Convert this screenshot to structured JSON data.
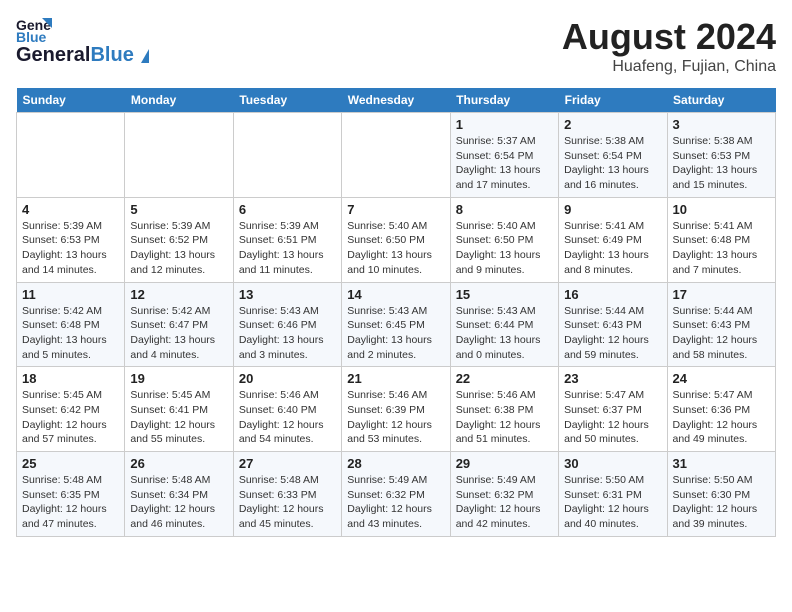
{
  "header": {
    "logo_general": "General",
    "logo_blue": "Blue",
    "title": "August 2024",
    "subtitle": "Huafeng, Fujian, China"
  },
  "days_of_week": [
    "Sunday",
    "Monday",
    "Tuesday",
    "Wednesday",
    "Thursday",
    "Friday",
    "Saturday"
  ],
  "weeks": [
    [
      {
        "day": "",
        "info": ""
      },
      {
        "day": "",
        "info": ""
      },
      {
        "day": "",
        "info": ""
      },
      {
        "day": "",
        "info": ""
      },
      {
        "day": "1",
        "info": "Sunrise: 5:37 AM\nSunset: 6:54 PM\nDaylight: 13 hours\nand 17 minutes."
      },
      {
        "day": "2",
        "info": "Sunrise: 5:38 AM\nSunset: 6:54 PM\nDaylight: 13 hours\nand 16 minutes."
      },
      {
        "day": "3",
        "info": "Sunrise: 5:38 AM\nSunset: 6:53 PM\nDaylight: 13 hours\nand 15 minutes."
      }
    ],
    [
      {
        "day": "4",
        "info": "Sunrise: 5:39 AM\nSunset: 6:53 PM\nDaylight: 13 hours\nand 14 minutes."
      },
      {
        "day": "5",
        "info": "Sunrise: 5:39 AM\nSunset: 6:52 PM\nDaylight: 13 hours\nand 12 minutes."
      },
      {
        "day": "6",
        "info": "Sunrise: 5:39 AM\nSunset: 6:51 PM\nDaylight: 13 hours\nand 11 minutes."
      },
      {
        "day": "7",
        "info": "Sunrise: 5:40 AM\nSunset: 6:50 PM\nDaylight: 13 hours\nand 10 minutes."
      },
      {
        "day": "8",
        "info": "Sunrise: 5:40 AM\nSunset: 6:50 PM\nDaylight: 13 hours\nand 9 minutes."
      },
      {
        "day": "9",
        "info": "Sunrise: 5:41 AM\nSunset: 6:49 PM\nDaylight: 13 hours\nand 8 minutes."
      },
      {
        "day": "10",
        "info": "Sunrise: 5:41 AM\nSunset: 6:48 PM\nDaylight: 13 hours\nand 7 minutes."
      }
    ],
    [
      {
        "day": "11",
        "info": "Sunrise: 5:42 AM\nSunset: 6:48 PM\nDaylight: 13 hours\nand 5 minutes."
      },
      {
        "day": "12",
        "info": "Sunrise: 5:42 AM\nSunset: 6:47 PM\nDaylight: 13 hours\nand 4 minutes."
      },
      {
        "day": "13",
        "info": "Sunrise: 5:43 AM\nSunset: 6:46 PM\nDaylight: 13 hours\nand 3 minutes."
      },
      {
        "day": "14",
        "info": "Sunrise: 5:43 AM\nSunset: 6:45 PM\nDaylight: 13 hours\nand 2 minutes."
      },
      {
        "day": "15",
        "info": "Sunrise: 5:43 AM\nSunset: 6:44 PM\nDaylight: 13 hours\nand 0 minutes."
      },
      {
        "day": "16",
        "info": "Sunrise: 5:44 AM\nSunset: 6:43 PM\nDaylight: 12 hours\nand 59 minutes."
      },
      {
        "day": "17",
        "info": "Sunrise: 5:44 AM\nSunset: 6:43 PM\nDaylight: 12 hours\nand 58 minutes."
      }
    ],
    [
      {
        "day": "18",
        "info": "Sunrise: 5:45 AM\nSunset: 6:42 PM\nDaylight: 12 hours\nand 57 minutes."
      },
      {
        "day": "19",
        "info": "Sunrise: 5:45 AM\nSunset: 6:41 PM\nDaylight: 12 hours\nand 55 minutes."
      },
      {
        "day": "20",
        "info": "Sunrise: 5:46 AM\nSunset: 6:40 PM\nDaylight: 12 hours\nand 54 minutes."
      },
      {
        "day": "21",
        "info": "Sunrise: 5:46 AM\nSunset: 6:39 PM\nDaylight: 12 hours\nand 53 minutes."
      },
      {
        "day": "22",
        "info": "Sunrise: 5:46 AM\nSunset: 6:38 PM\nDaylight: 12 hours\nand 51 minutes."
      },
      {
        "day": "23",
        "info": "Sunrise: 5:47 AM\nSunset: 6:37 PM\nDaylight: 12 hours\nand 50 minutes."
      },
      {
        "day": "24",
        "info": "Sunrise: 5:47 AM\nSunset: 6:36 PM\nDaylight: 12 hours\nand 49 minutes."
      }
    ],
    [
      {
        "day": "25",
        "info": "Sunrise: 5:48 AM\nSunset: 6:35 PM\nDaylight: 12 hours\nand 47 minutes."
      },
      {
        "day": "26",
        "info": "Sunrise: 5:48 AM\nSunset: 6:34 PM\nDaylight: 12 hours\nand 46 minutes."
      },
      {
        "day": "27",
        "info": "Sunrise: 5:48 AM\nSunset: 6:33 PM\nDaylight: 12 hours\nand 45 minutes."
      },
      {
        "day": "28",
        "info": "Sunrise: 5:49 AM\nSunset: 6:32 PM\nDaylight: 12 hours\nand 43 minutes."
      },
      {
        "day": "29",
        "info": "Sunrise: 5:49 AM\nSunset: 6:32 PM\nDaylight: 12 hours\nand 42 minutes."
      },
      {
        "day": "30",
        "info": "Sunrise: 5:50 AM\nSunset: 6:31 PM\nDaylight: 12 hours\nand 40 minutes."
      },
      {
        "day": "31",
        "info": "Sunrise: 5:50 AM\nSunset: 6:30 PM\nDaylight: 12 hours\nand 39 minutes."
      }
    ]
  ]
}
